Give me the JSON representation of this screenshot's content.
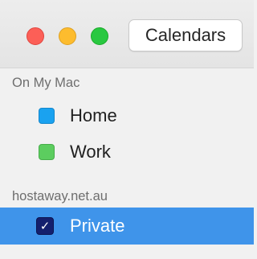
{
  "window": {
    "controls": {
      "close_color": "#fc5f57",
      "minimize_color": "#fdbc2e",
      "zoom_color": "#29c840"
    },
    "toolbar": {
      "calendars_button_label": "Calendars"
    }
  },
  "sidebar": {
    "sections": [
      {
        "header": "On My Mac",
        "items": [
          {
            "label": "Home",
            "color": "#1aa2f0"
          },
          {
            "label": "Work",
            "color": "#5ccd5f"
          }
        ]
      },
      {
        "header": "hostaway.net.au",
        "items": [
          {
            "label": "Private",
            "checked": true,
            "selected": true,
            "color": "#14206e"
          }
        ]
      }
    ],
    "selection_color": "#3f94ea",
    "check_glyph": "✓"
  }
}
